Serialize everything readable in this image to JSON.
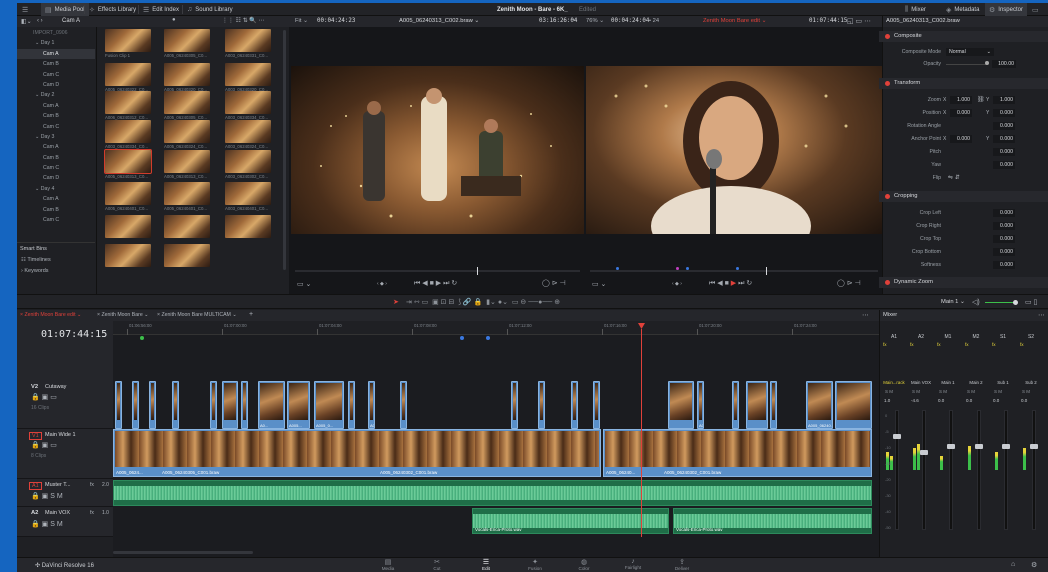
{
  "window": {
    "app_title": "Zenith Moon - Bare - 6K_",
    "status": "Edited"
  },
  "top_toolbar": {
    "media_pool": "Media Pool",
    "effects_library": "Effects Library",
    "edit_index": "Edit Index",
    "sound_library": "Sound Library",
    "mixer": "Mixer",
    "metadata": "Metadata",
    "inspector": "Inspector"
  },
  "media_pool": {
    "current_bin": "Cam A",
    "tree": [
      "IMPORT_0906",
      "Day 1",
      "Cam A",
      "Cam B",
      "Cam C",
      "Cam D",
      "Day 2",
      "Cam A",
      "Cam B",
      "Cam C",
      "Day 3",
      "Cam A",
      "Cam B",
      "Cam C",
      "Cam D",
      "Day 4",
      "Cam A",
      "Cam B",
      "Cam C"
    ],
    "smart_bins": "Smart Bins",
    "smart_items": [
      "Timelines",
      "Keywords"
    ],
    "thumbs": [
      "Fusion Clip 1",
      "A005_06240305_C0...",
      "A003_06240331_C0...",
      "A005_06240322_C0...",
      "A005_06240320_C0...",
      "A003_06240320_C0...",
      "A006_06240312_C0...",
      "A005_06240305_C0...",
      "A003_06240334_C0...",
      "A003_06240334_C0...",
      "A005_06240324_C0...",
      "A003_06240324_C0...",
      "A005_06240313_C0...",
      "A005_06240313_C0...",
      "A003_06240302_C0...",
      "A005_06240401_C0...",
      "A005_06240401_C0...",
      "A003_06240401_C0...",
      "",
      ""
    ]
  },
  "source_viewer": {
    "fit": "Fit",
    "timecode_in": "00:04:24:23",
    "clip_name": "A005_06240313_C002.braw",
    "timecode_out": "03:16:26:04"
  },
  "timeline_viewer": {
    "zoom": "76%",
    "timecode": "00:04:24:04",
    "fps": "24",
    "timeline_name": "Zenith Moon Bare edit",
    "timecode_out": "01:07:44:15"
  },
  "inspector": {
    "clip_name": "A005_06240313_C002.braw",
    "composite": "Composite",
    "composite_mode_label": "Composite Mode",
    "composite_mode": "Normal",
    "opacity_label": "Opacity",
    "opacity": "100.00",
    "transform": "Transform",
    "zoom_label": "Zoom",
    "zoom_x": "1.000",
    "zoom_y": "1.000",
    "position_label": "Position",
    "pos_x": "0.000",
    "pos_y": "0.000",
    "rotation_label": "Rotation Angle",
    "rotation": "0.000",
    "anchor_label": "Anchor Point",
    "anchor_x": "0.000",
    "anchor_y": "0.000",
    "pitch_label": "Pitch",
    "pitch": "0.000",
    "yaw_label": "Yaw",
    "yaw": "0.000",
    "flip_label": "Flip",
    "cropping": "Cropping",
    "crop_left_label": "Crop Left",
    "crop_left": "0.000",
    "crop_right_label": "Crop Right",
    "crop_right": "0.000",
    "crop_top_label": "Crop Top",
    "crop_top": "0.000",
    "crop_bottom_label": "Crop Bottom",
    "crop_bottom": "0.000",
    "softness_label": "Softness",
    "softness": "0.000",
    "dynamic_zoom": "Dynamic Zoom",
    "x": "X",
    "y": "Y"
  },
  "timeline": {
    "tabs": [
      "Zenith Moon Bare edit",
      "Zenith Moon Bare",
      "Zenith Moon Bare MULTICAM"
    ],
    "timecode": "01:07:44:15",
    "ruler": [
      "01:06:56:00",
      "01:07:00:00",
      "01:07:04:00",
      "01:07:08:00",
      "01:07:12:00",
      "01:07:16:00",
      "01:07:20:00",
      "01:07:24:00",
      "01:07:28:00"
    ],
    "tracks": {
      "v2": {
        "id": "V2",
        "name": "Cutaway",
        "count": "16 Clips"
      },
      "v1": {
        "id": "V1",
        "name": "Main Wide 1",
        "count": "8 Clips"
      },
      "a1": {
        "id": "A1",
        "name": "Muster T...",
        "fx": "fx",
        "level": "2.0"
      },
      "a2": {
        "id": "A2",
        "name": "Main VOX",
        "fx": "fx",
        "level": "1.0"
      }
    },
    "clip_labels": [
      "A005_0624...",
      "A005_06240305_C001.braw",
      "A005_06240302_C001.braw",
      "A005_06240...",
      "A005_06240302_C001.braw"
    ],
    "audio_labels": [
      "Vocals-Erica-Proto.wav",
      "Vocals-Erica-Proto.wav"
    ],
    "v2_labels": [
      "A0...",
      "A005...",
      "A005_0...",
      "A0...",
      "A005_0...",
      "A005_0...",
      "A005_06240..."
    ]
  },
  "mixer": {
    "title": "Mixer",
    "main": "Main 1",
    "channels": [
      "A1",
      "A2",
      "M1",
      "M2",
      "S1",
      "S2"
    ],
    "fx": "fx",
    "names": [
      "Main...rack",
      "Main VOX",
      "Main 1",
      "Main 2",
      "Sub 1",
      "Sub 2"
    ],
    "levels": [
      "1.0",
      "-4.6",
      "0.0",
      "0.0",
      "0.0",
      "0.0"
    ],
    "scale": [
      "0",
      "-5",
      "-10",
      "-15",
      "-20",
      "-30",
      "-40",
      "-50"
    ]
  },
  "pages": [
    "Media",
    "Cut",
    "Edit",
    "Fusion",
    "Color",
    "Fairlight",
    "Deliver"
  ],
  "brand": "DaVinci Resolve 16",
  "colors": {
    "accent": "#e0413a",
    "clip_blue": "#5a8fc8",
    "audio_green": "#2d8a5c"
  }
}
